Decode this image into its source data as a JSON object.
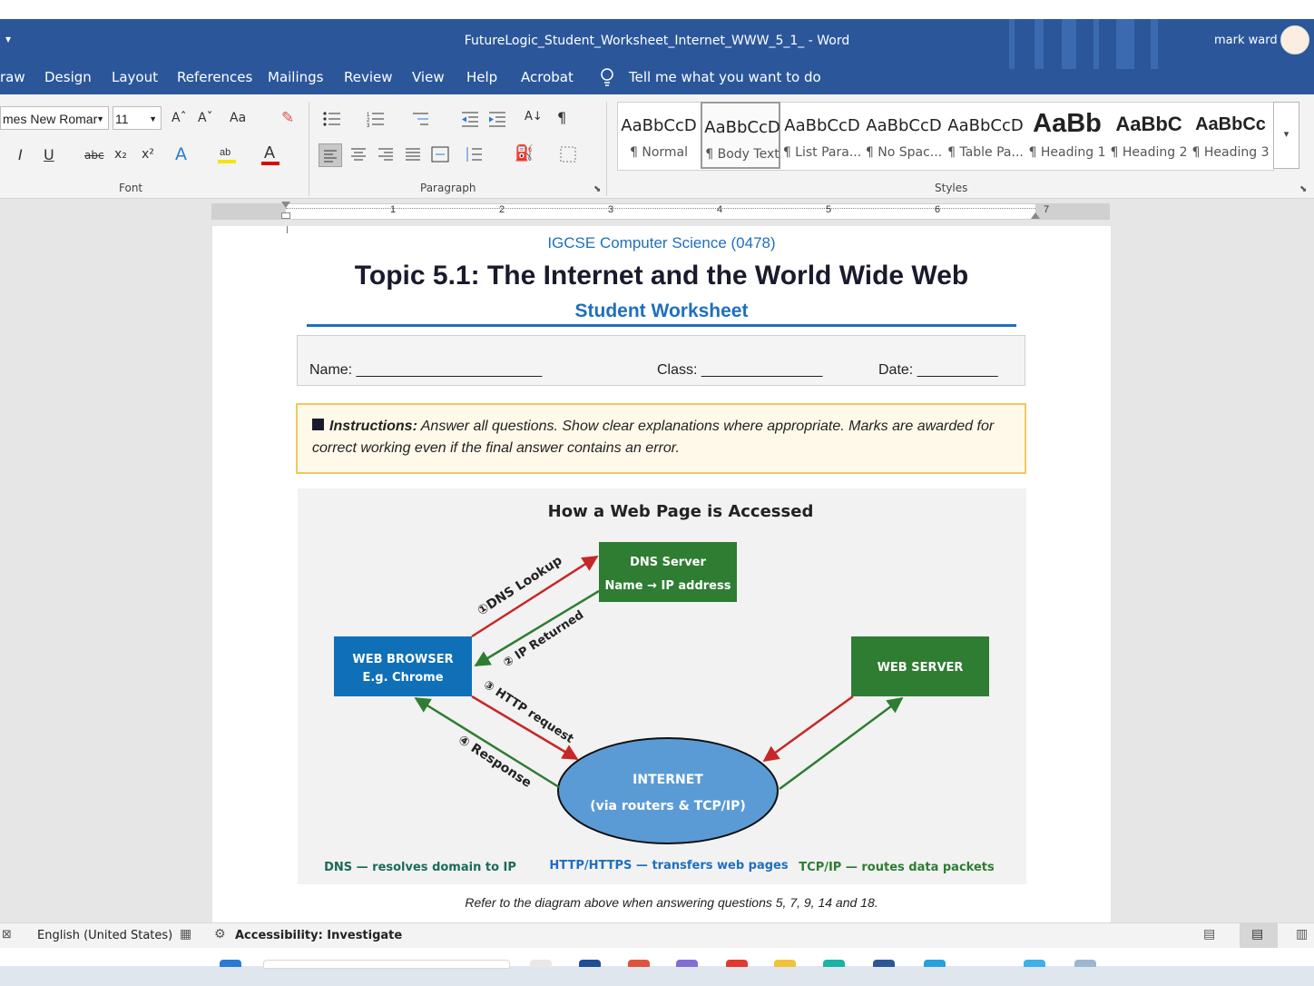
{
  "window": {
    "title": "FutureLogic_Student_Worksheet_Internet_WWW_5_1_  -  Word",
    "user": "mark ward",
    "qat_glyph": "▾"
  },
  "menu": [
    "raw",
    "Design",
    "Layout",
    "References",
    "Mailings",
    "Review",
    "View",
    "Help",
    "Acrobat"
  ],
  "tell_me": "Tell me what you want to do",
  "ribbon": {
    "font_name": "mes New Romar",
    "font_size": "11",
    "font_label": "Font",
    "paragraph_label": "Paragraph",
    "styles_label": "Styles",
    "grow": "Aˆ",
    "shrink": "Aˇ",
    "case": "Aa",
    "italic": "I",
    "underline": "U",
    "strike": "abc",
    "sub": "x₂",
    "sup": "x²",
    "pilcrow": "¶",
    "styles": [
      {
        "sample": "AaBbCcD",
        "name": "¶ Normal"
      },
      {
        "sample": "AaBbCcD",
        "name": "¶ Body Text"
      },
      {
        "sample": "AaBbCcD",
        "name": "¶ List Para..."
      },
      {
        "sample": "AaBbCcD",
        "name": "¶ No Spac..."
      },
      {
        "sample": "AaBbCcD",
        "name": "¶ Table Pa..."
      },
      {
        "sample": "AaBb",
        "name": "¶ Heading 1"
      },
      {
        "sample": "AaBbC",
        "name": "¶ Heading 2"
      },
      {
        "sample": "AaBbCc",
        "name": "¶ Heading 3"
      }
    ]
  },
  "ruler_numbers": [
    "1",
    "2",
    "3",
    "4",
    "5",
    "6",
    "7"
  ],
  "document": {
    "course": "IGCSE Computer Science (0478)",
    "title": "Topic 5.1: The Internet and the World Wide Web",
    "subtitle": "Student Worksheet",
    "name_label": "Name: _______________________",
    "class_label": "Class: _______________",
    "date_label": "Date: __________",
    "instructions_bold": "Instructions:",
    "instructions_text": " Answer all questions. Show clear explanations where appropriate. Marks are awarded for correct working even if the final answer contains an error.",
    "caption": "Refer to the diagram above when answering questions 5, 7, 9, 14 and 18."
  },
  "diagram": {
    "title": "How a Web Page is Accessed",
    "dns_server_line1": "DNS Server",
    "dns_server_line2": "Name →  IP address",
    "browser_line1": "WEB BROWSER",
    "browser_line2": "E.g. Chrome",
    "web_server": "WEB SERVER",
    "internet_line1": "INTERNET",
    "internet_line2": "(via routers & TCP/IP)",
    "step1": "①DNS Lookup",
    "step2": "② IP Returned",
    "step3": "③ HTTP request",
    "step4": "④ Response",
    "legend_dns": "DNS — resolves domain to IP",
    "legend_http": "HTTP/HTTPS — transfers web pages",
    "legend_tcp": "TCP/IP — routes data packets",
    "colors": {
      "green": "#2e7d32",
      "blue": "#0f70b7",
      "red": "#c62828",
      "ellipse": "#5b9bd5"
    }
  },
  "status": {
    "language": "English (United States)",
    "accessibility": "Accessibility: Investigate"
  }
}
